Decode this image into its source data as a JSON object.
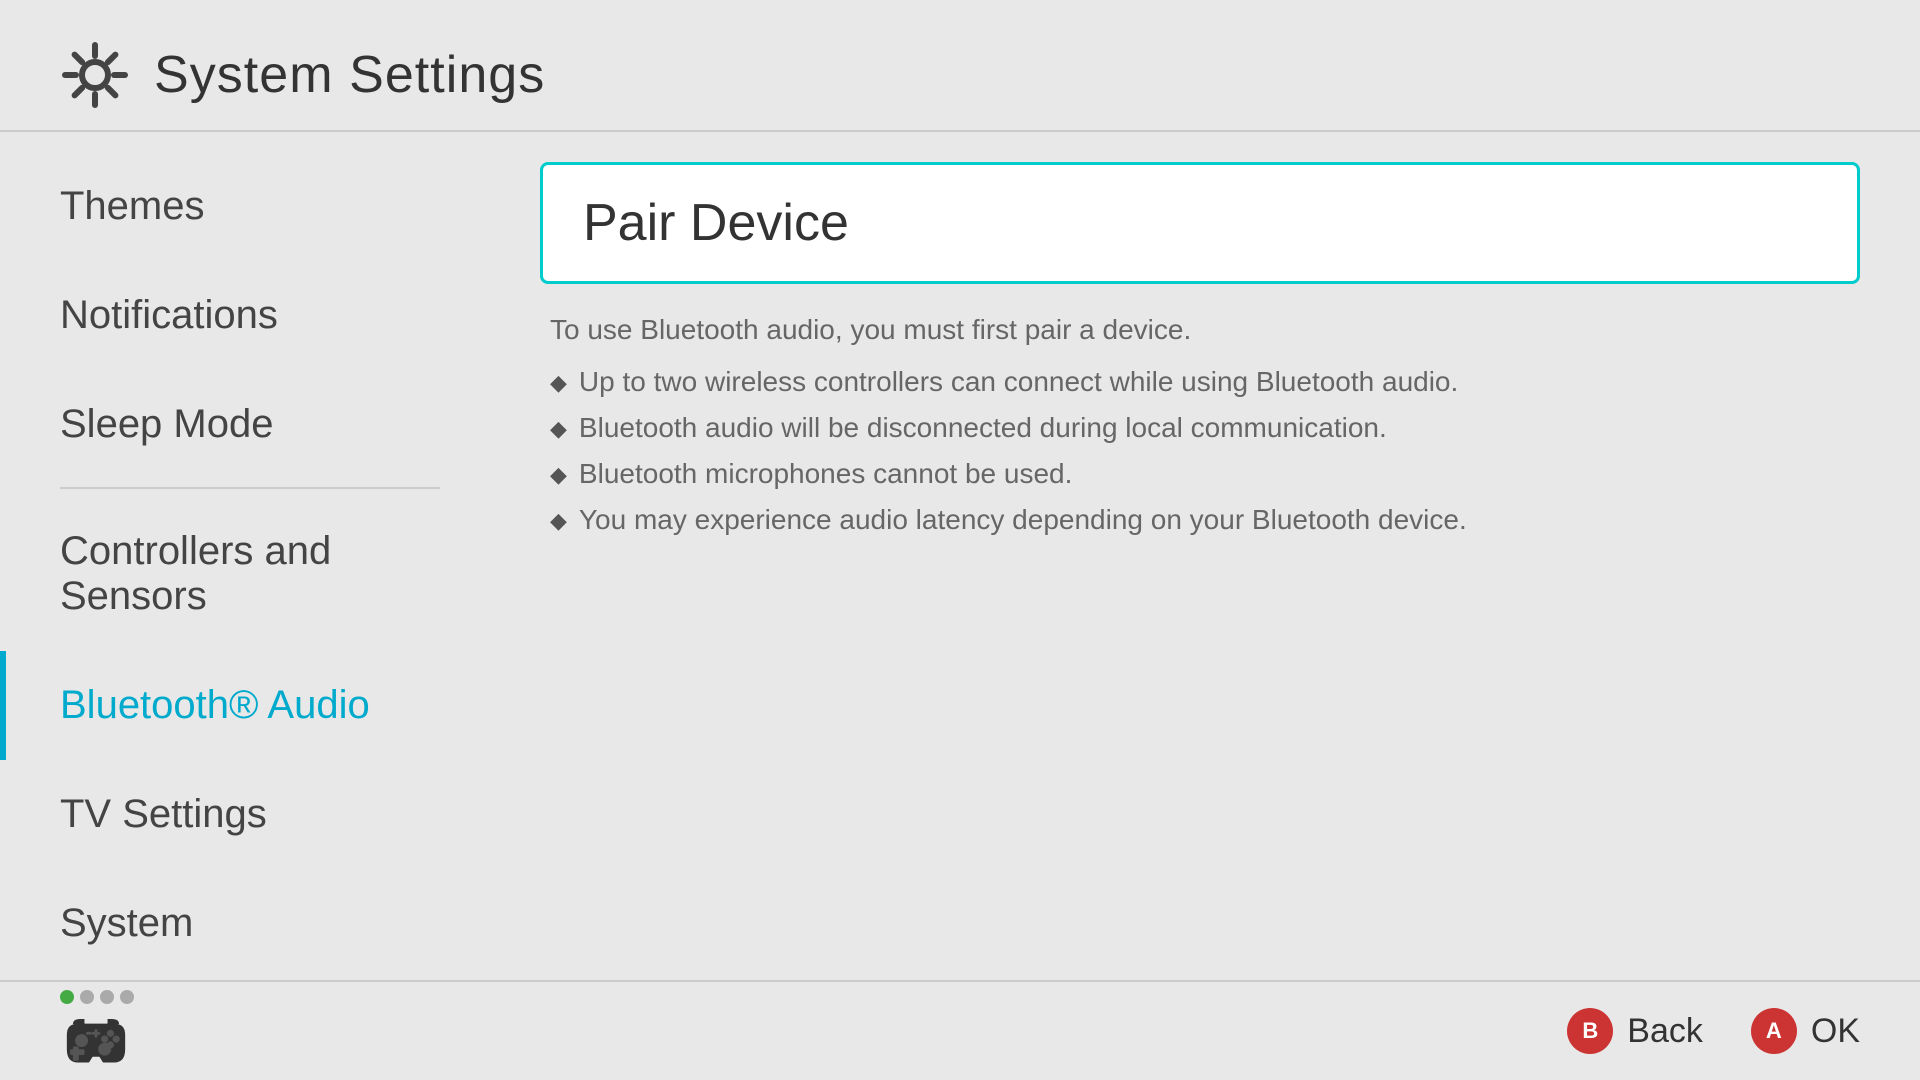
{
  "header": {
    "title": "System Settings",
    "icon": "gear"
  },
  "sidebar": {
    "items": [
      {
        "id": "themes",
        "label": "Themes",
        "active": false
      },
      {
        "id": "notifications",
        "label": "Notifications",
        "active": false
      },
      {
        "id": "sleep-mode",
        "label": "Sleep Mode",
        "active": false
      },
      {
        "id": "controllers-sensors",
        "label": "Controllers and Sensors",
        "active": false
      },
      {
        "id": "bluetooth-audio",
        "label": "Bluetooth® Audio",
        "active": true
      },
      {
        "id": "tv-settings",
        "label": "TV Settings",
        "active": false
      },
      {
        "id": "system",
        "label": "System",
        "active": false
      }
    ]
  },
  "main": {
    "pair_device_label": "Pair Device",
    "intro_text": "To use Bluetooth audio, you must first pair a device.",
    "bullets": [
      "Up to two wireless controllers can connect while using Bluetooth audio.",
      "Bluetooth audio will be disconnected during local communication.",
      "Bluetooth microphones cannot be used.",
      "You may experience audio latency depending on your Bluetooth device."
    ]
  },
  "footer": {
    "back_label": "Back",
    "ok_label": "OK",
    "btn_b": "B",
    "btn_a": "A"
  },
  "colors": {
    "active_border": "#00cccc",
    "active_text": "#00aacc",
    "btn_b_color": "#cc3333",
    "btn_a_color": "#cc3333",
    "dot_active": "#44aa44",
    "dot_inactive": "#aaaaaa"
  }
}
